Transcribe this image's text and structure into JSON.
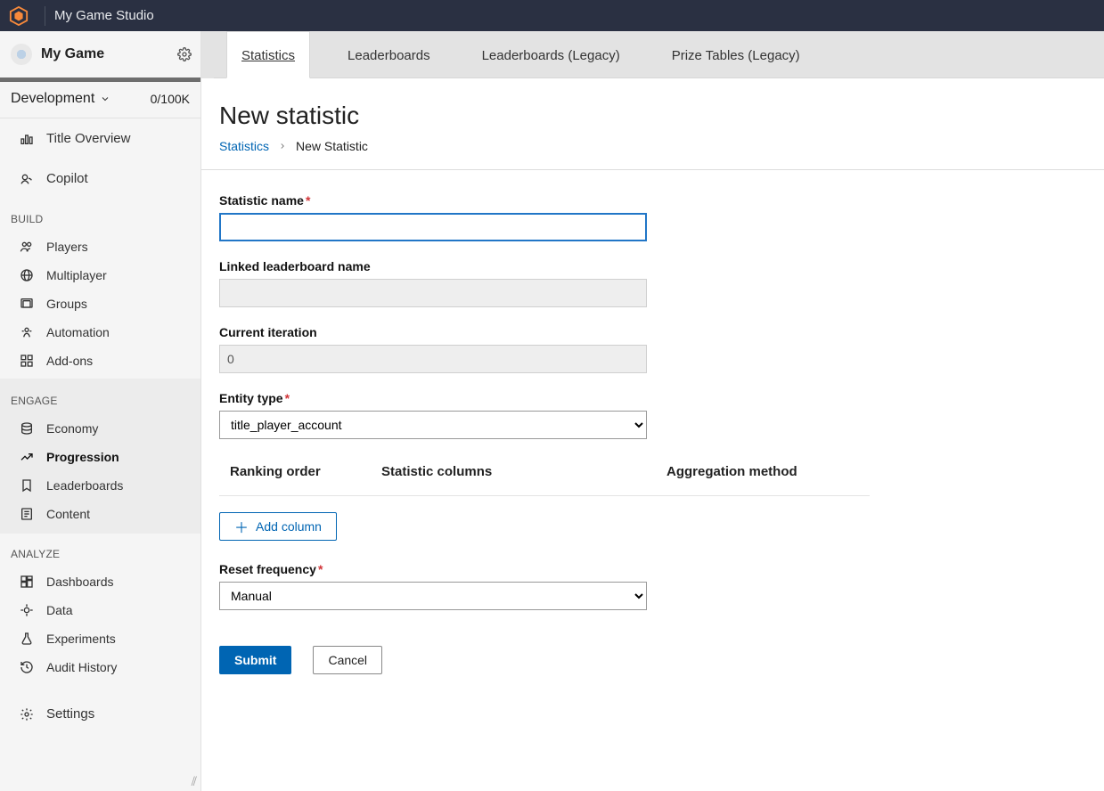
{
  "topbar": {
    "studio_name": "My Game Studio"
  },
  "sidebar": {
    "game_name": "My Game",
    "environment": "Development",
    "counter": "0/100K",
    "item_title_overview": "Title Overview",
    "item_copilot": "Copilot",
    "section_build": "BUILD",
    "item_players": "Players",
    "item_multiplayer": "Multiplayer",
    "item_groups": "Groups",
    "item_automation": "Automation",
    "item_addons": "Add-ons",
    "section_engage": "ENGAGE",
    "item_economy": "Economy",
    "item_progression": "Progression",
    "item_leaderboards": "Leaderboards",
    "item_content": "Content",
    "section_analyze": "ANALYZE",
    "item_dashboards": "Dashboards",
    "item_data": "Data",
    "item_experiments": "Experiments",
    "item_audit": "Audit History",
    "item_settings": "Settings"
  },
  "tabs": {
    "statistics": "Statistics",
    "leaderboards": "Leaderboards",
    "leaderboards_legacy": "Leaderboards (Legacy)",
    "prize_tables_legacy": "Prize Tables (Legacy)"
  },
  "page": {
    "title": "New statistic",
    "breadcrumb_root": "Statistics",
    "breadcrumb_current": "New Statistic"
  },
  "form": {
    "stat_name_label": "Statistic name",
    "stat_name_value": "",
    "linked_label": "Linked leaderboard name",
    "linked_value": "",
    "iteration_label": "Current iteration",
    "iteration_value": "0",
    "entity_label": "Entity type",
    "entity_value": "title_player_account",
    "columns": {
      "ranking": "Ranking order",
      "statcols": "Statistic columns",
      "agg": "Aggregation method"
    },
    "add_column": "Add column",
    "reset_label": "Reset frequency",
    "reset_value": "Manual",
    "submit": "Submit",
    "cancel": "Cancel"
  }
}
